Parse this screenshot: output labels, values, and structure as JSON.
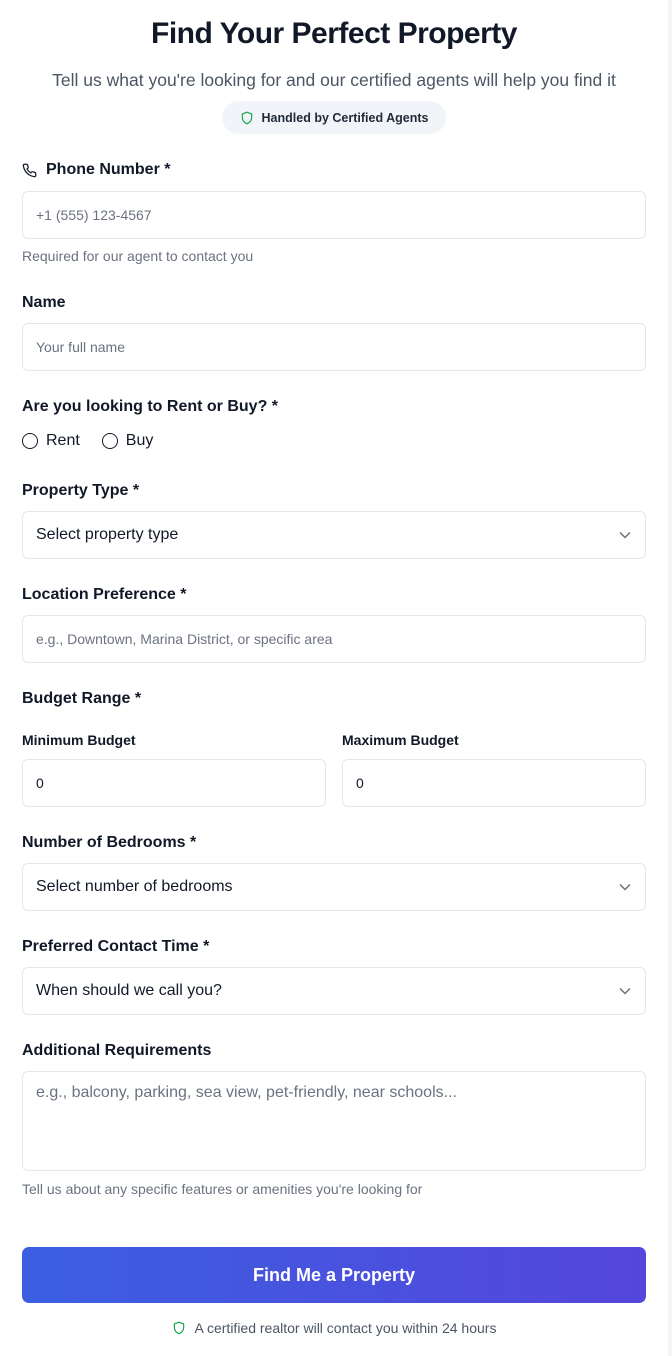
{
  "header": {
    "title": "Find Your Perfect Property",
    "subtitle": "Tell us what you're looking for and our certified agents will help you find it",
    "badge": "Handled by Certified Agents"
  },
  "phone": {
    "label": "Phone Number *",
    "placeholder": "+1 (555) 123-4567",
    "help": "Required for our agent to contact you"
  },
  "name": {
    "label": "Name",
    "placeholder": "Your full name"
  },
  "intent": {
    "label": "Are you looking to Rent or Buy? *",
    "options": [
      "Rent",
      "Buy"
    ]
  },
  "property_type": {
    "label": "Property Type *",
    "selected": "Select property type"
  },
  "location": {
    "label": "Location Preference *",
    "placeholder": "e.g., Downtown, Marina District, or specific area"
  },
  "budget": {
    "label": "Budget Range *",
    "min_label": "Minimum Budget",
    "max_label": "Maximum Budget",
    "min_value": "0",
    "max_value": "0"
  },
  "bedrooms": {
    "label": "Number of Bedrooms *",
    "selected": "Select number of bedrooms"
  },
  "contact_time": {
    "label": "Preferred Contact Time *",
    "selected": "When should we call you?"
  },
  "additional": {
    "label": "Additional Requirements",
    "placeholder": "e.g., balcony, parking, sea view, pet-friendly, near schools...",
    "help": "Tell us about any specific features or amenities you're looking for"
  },
  "submit_label": "Find Me a Property",
  "footer_note": "A certified realtor will contact you within 24 hours",
  "colors": {
    "accent_start": "#3b5fe0",
    "accent_end": "#5546dc",
    "shield_green": "#16a34a"
  },
  "icons": [
    "shield-icon",
    "phone-icon",
    "chevron-down-icon"
  ]
}
